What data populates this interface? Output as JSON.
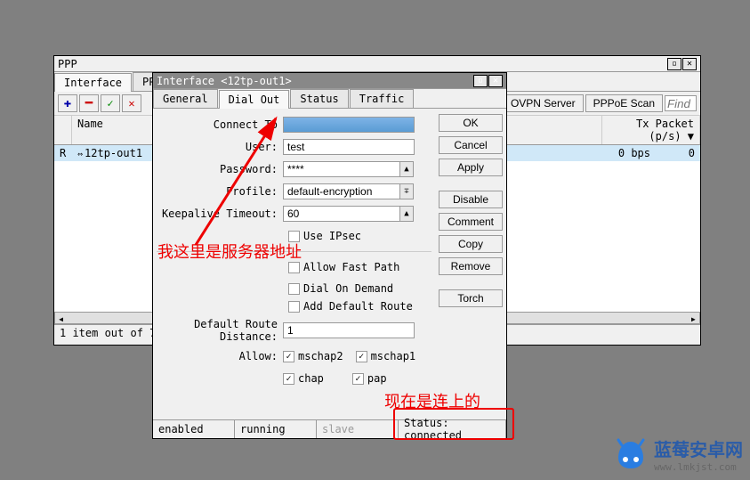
{
  "main_window": {
    "title": "PPP",
    "tabs": [
      "Interface",
      "PPPoE"
    ],
    "active_tab": 0,
    "toolbar": {
      "ovpn_server": "OVPN Server",
      "pppoe_scan": "PPPoE Scan",
      "find_placeholder": "Find"
    },
    "table": {
      "headers": [
        "",
        "Name",
        "Tx Packet (p/s)"
      ],
      "rows": [
        {
          "flag": "R",
          "name": "12tp-out1",
          "tx_bps": "0 bps",
          "tx_packet": "0"
        }
      ]
    },
    "footer": "1 item out of 7"
  },
  "dialog": {
    "title": "Interface <12tp-out1>",
    "tabs": [
      "General",
      "Dial Out",
      "Status",
      "Traffic"
    ],
    "active_tab": 1,
    "buttons": {
      "ok": "OK",
      "cancel": "Cancel",
      "apply": "Apply",
      "disable": "Disable",
      "comment": "Comment",
      "copy": "Copy",
      "remove": "Remove",
      "torch": "Torch"
    },
    "fields": {
      "connect_to_label": "Connect To",
      "connect_to_value": "",
      "user_label": "User:",
      "user_value": "test",
      "password_label": "Password:",
      "password_value": "****",
      "profile_label": "Profile:",
      "profile_value": "default-encryption",
      "keepalive_label": "Keepalive Timeout:",
      "keepalive_value": "60",
      "use_ipsec_label": "Use IPsec",
      "allow_fastpath_label": "Allow Fast Path",
      "dial_on_demand_label": "Dial On Demand",
      "add_default_route_label": "Add Default Route",
      "default_route_distance_label": "Default Route Distance:",
      "default_route_distance_value": "1",
      "allow_label": "Allow:",
      "mschap2_label": "mschap2",
      "mschap1_label": "mschap1",
      "chap_label": "chap",
      "pap_label": "pap"
    },
    "status": {
      "enabled": "enabled",
      "running": "running",
      "slave": "slave",
      "status": "Status: connected"
    }
  },
  "annotations": {
    "server_note": "我这里是服务器地址",
    "connected_note": "现在是连上的"
  },
  "watermark": {
    "name": "蓝莓安卓网",
    "url": "www.lmkjst.com"
  }
}
